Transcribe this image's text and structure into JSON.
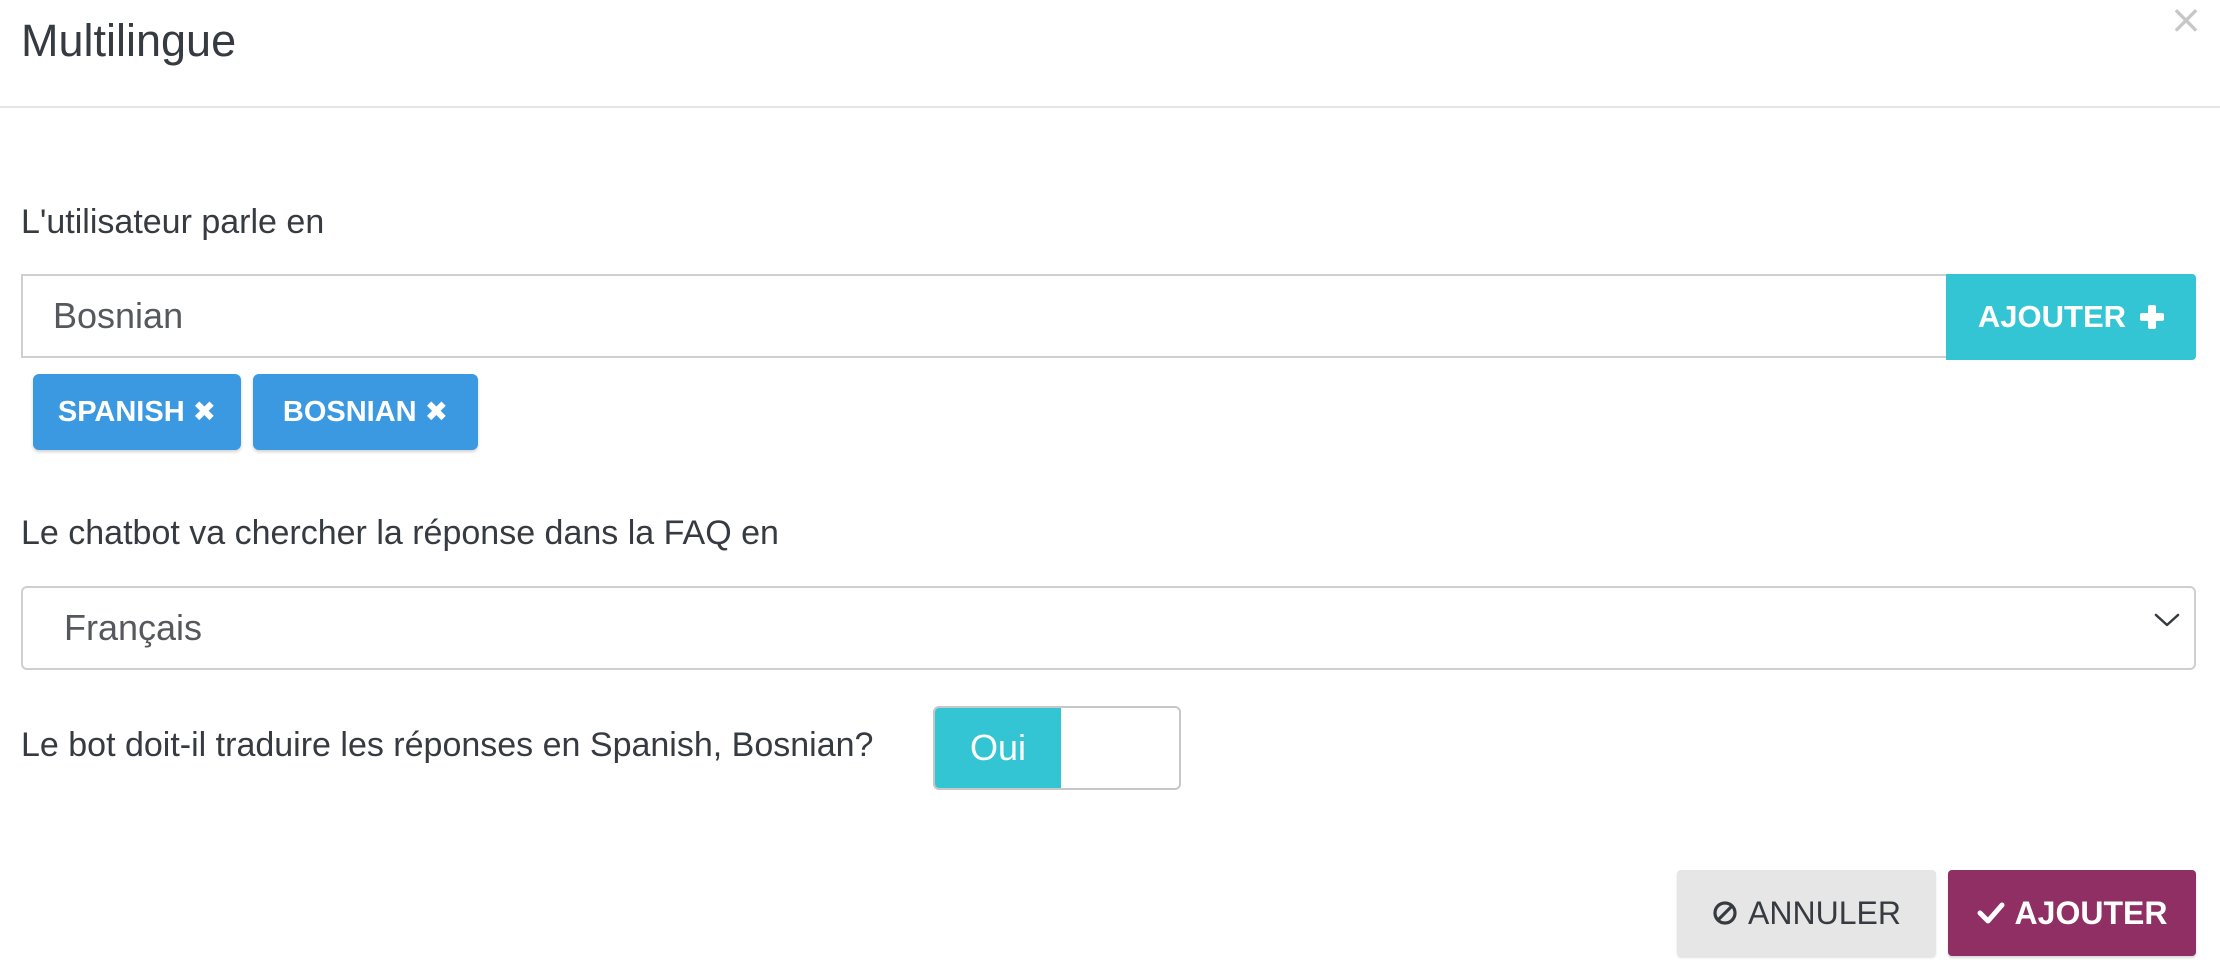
{
  "modal": {
    "title": "Multilingue",
    "close_glyph": "×"
  },
  "user_language": {
    "label": "L'utilisateur parle en",
    "input_value": "Bosnian",
    "add_button_label": "AJOUTER",
    "add_button_icon": "plus-icon",
    "tags": [
      {
        "label": "SPANISH",
        "icon": "remove-icon"
      },
      {
        "label": "BOSNIAN",
        "icon": "remove-icon"
      }
    ]
  },
  "faq_language": {
    "label": "Le chatbot va chercher la réponse dans la FAQ en",
    "selected": "Français",
    "icon": "chevron-down-icon"
  },
  "translate": {
    "question": "Le bot doit-il traduire les réponses en Spanish, Bosnian?",
    "toggle_on_label": "Oui"
  },
  "footer": {
    "cancel_label": "ANNULER",
    "cancel_icon": "ban-icon",
    "submit_label": "AJOUTER",
    "submit_icon": "check-icon"
  },
  "colors": {
    "accent": "#33c5d3",
    "tag": "#3a99e0",
    "primary_button": "#8f2f63",
    "secondary_button": "#e6e6e6"
  }
}
